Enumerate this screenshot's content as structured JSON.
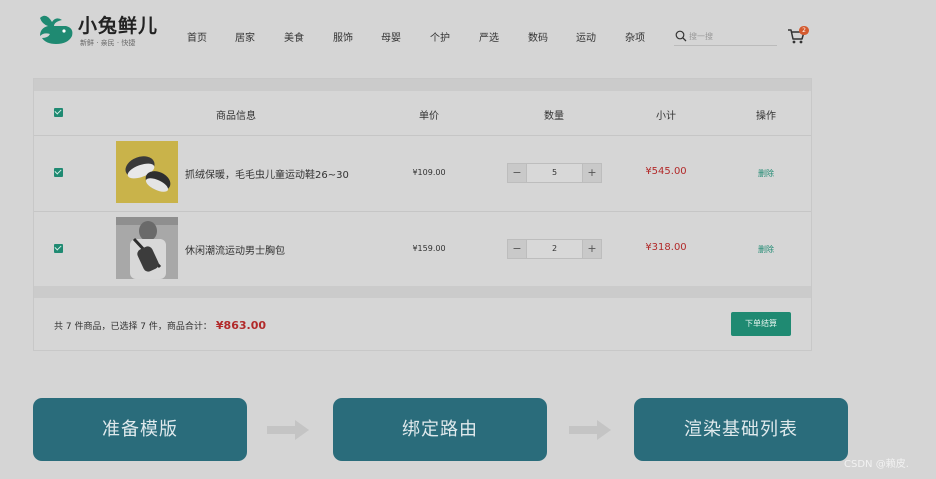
{
  "header": {
    "logo_text": "小兔鲜儿",
    "logo_slogan": "新鲜 · 亲民 · 快捷",
    "nav": [
      "首页",
      "居家",
      "美食",
      "服饰",
      "母婴",
      "个护",
      "严选",
      "数码",
      "运动",
      "杂项"
    ],
    "search_placeholder": "搜一搜",
    "cart_count": "2"
  },
  "table": {
    "headers": [
      "商品信息",
      "单价",
      "数量",
      "小计",
      "操作"
    ],
    "rows": [
      {
        "name": "抓绒保暖，毛毛虫儿童运动鞋26~30",
        "price": "¥109.00",
        "qty": "5",
        "subtotal": "¥545.00",
        "action": "删除"
      },
      {
        "name": "休闲潮流运动男士胸包",
        "price": "¥159.00",
        "qty": "2",
        "subtotal": "¥318.00",
        "action": "删除"
      }
    ],
    "summary_text": "共 7 件商品，已选择 7 件，商品合计：",
    "summary_total": "¥863.00",
    "checkout_label": "下单结算"
  },
  "steps": [
    "准备模版",
    "绑定路由",
    "渲染基础列表"
  ],
  "watermark": "CSDN @赖皮."
}
